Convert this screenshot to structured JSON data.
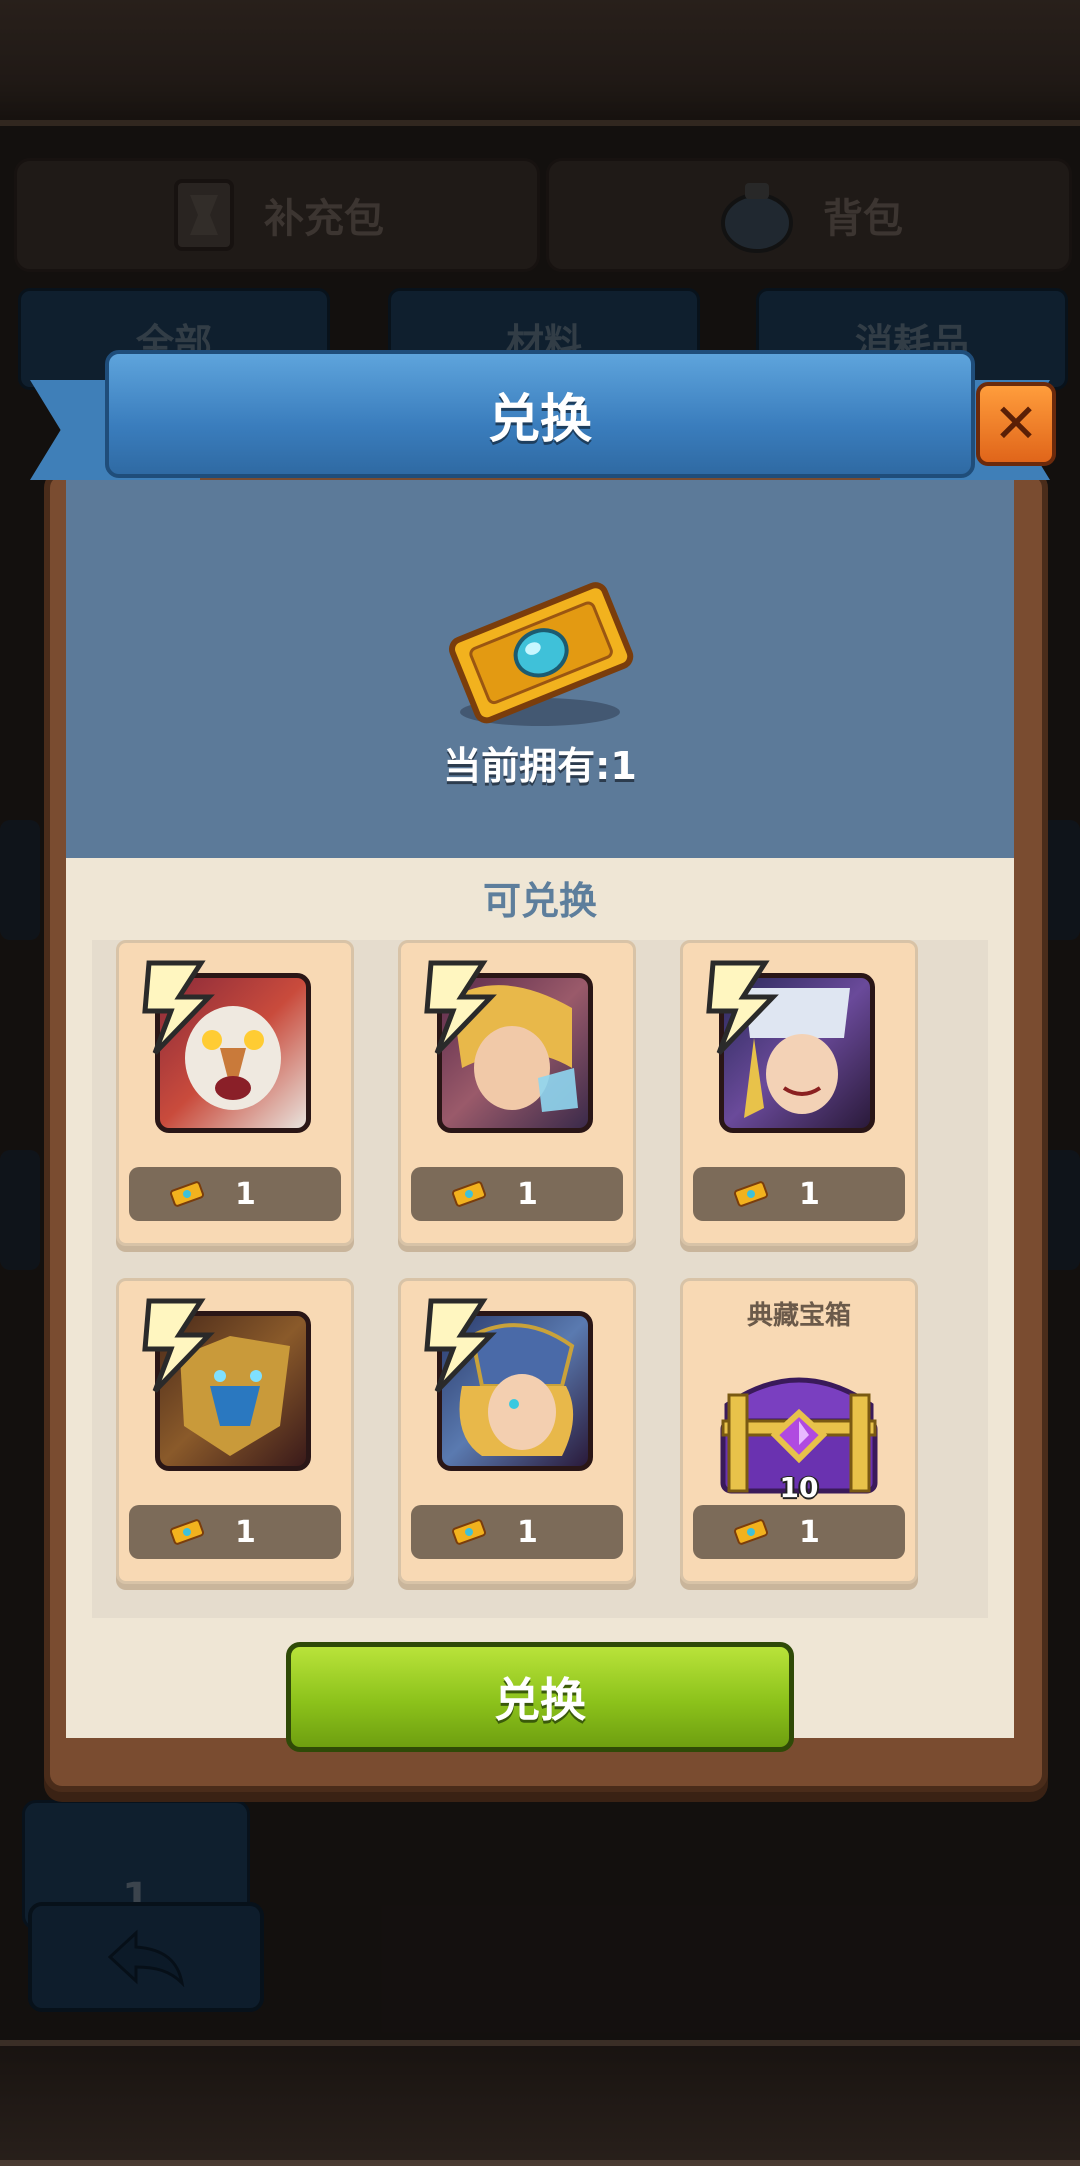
{
  "background": {
    "tabs": [
      {
        "label": "补充包",
        "icon": "card-pack-icon"
      },
      {
        "label": "背包",
        "icon": "potion-bag-icon"
      }
    ],
    "sub_tabs": [
      "全部",
      "材料",
      "消耗品"
    ],
    "item_count": "1"
  },
  "dialog": {
    "title": "兑换",
    "owned_text": "当前拥有:1",
    "section_title": "可兑换",
    "confirm_label": "兑换",
    "items": [
      {
        "type": "hero",
        "name": "bird-monster-hero-portrait",
        "cost": "1"
      },
      {
        "type": "hero",
        "name": "glass-slipper-maiden-hero-portrait",
        "cost": "1"
      },
      {
        "type": "hero",
        "name": "white-hooded-warrior-hero-portrait",
        "cost": "1"
      },
      {
        "type": "hero",
        "name": "golden-dragon-hero-portrait",
        "cost": "1"
      },
      {
        "type": "hero",
        "name": "helmeted-valkyrie-hero-portrait",
        "cost": "1"
      },
      {
        "type": "chest",
        "label": "典藏宝箱",
        "quantity": "10",
        "cost": "1"
      }
    ]
  },
  "colors": {
    "ribbon": "#3a7dbd",
    "confirm_button": "#8cc21b",
    "close_button": "#e0651a",
    "card": "#f8d9b4"
  }
}
